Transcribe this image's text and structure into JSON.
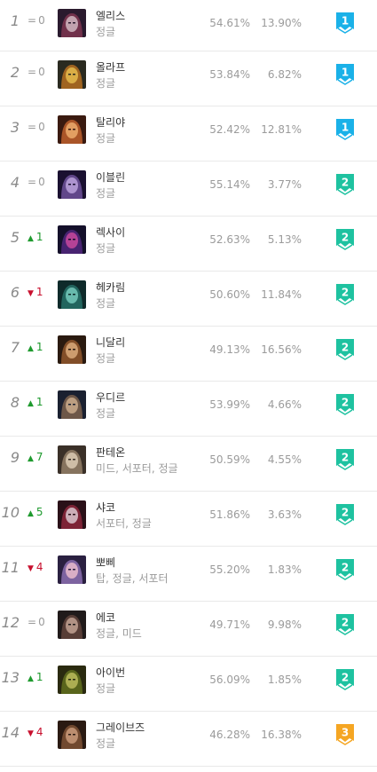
{
  "rows": [
    {
      "rank": "1",
      "change": "0",
      "dir": "same",
      "name": "엘리스",
      "role": "정글",
      "win": "54.61%",
      "pick": "13.90%",
      "tier": "1",
      "tierColor": "#1ab1e8",
      "avatar": {
        "bg": "#2a1a2e",
        "face": "#8a3a55",
        "accent": "#d7c0c8"
      }
    },
    {
      "rank": "2",
      "change": "0",
      "dir": "same",
      "name": "올라프",
      "role": "정글",
      "win": "53.84%",
      "pick": "6.82%",
      "tier": "1",
      "tierColor": "#1ab1e8",
      "avatar": {
        "bg": "#2a2a20",
        "face": "#c87820",
        "accent": "#e8c050"
      }
    },
    {
      "rank": "3",
      "change": "0",
      "dir": "same",
      "name": "탈리야",
      "role": "정글",
      "win": "52.42%",
      "pick": "12.81%",
      "tier": "1",
      "tierColor": "#1ab1e8",
      "avatar": {
        "bg": "#3a1a10",
        "face": "#d06a30",
        "accent": "#f0b070"
      }
    },
    {
      "rank": "4",
      "change": "0",
      "dir": "same",
      "name": "이블린",
      "role": "정글",
      "win": "55.14%",
      "pick": "3.77%",
      "tier": "2",
      "tierColor": "#1ec2a0",
      "avatar": {
        "bg": "#1a1030",
        "face": "#7a5aa8",
        "accent": "#c0a8e0"
      }
    },
    {
      "rank": "5",
      "change": "1",
      "dir": "up",
      "name": "렉사이",
      "role": "정글",
      "win": "52.63%",
      "pick": "5.13%",
      "tier": "2",
      "tierColor": "#1ec2a0",
      "avatar": {
        "bg": "#14102a",
        "face": "#5a2a8a",
        "accent": "#d04aa0"
      }
    },
    {
      "rank": "6",
      "change": "1",
      "dir": "down",
      "name": "헤카림",
      "role": "정글",
      "win": "50.60%",
      "pick": "11.84%",
      "tier": "2",
      "tierColor": "#1ec2a0",
      "avatar": {
        "bg": "#0e2a2a",
        "face": "#2a7a70",
        "accent": "#7ad0c0"
      }
    },
    {
      "rank": "7",
      "change": "1",
      "dir": "up",
      "name": "니달리",
      "role": "정글",
      "win": "49.13%",
      "pick": "16.56%",
      "tier": "2",
      "tierColor": "#1ec2a0",
      "avatar": {
        "bg": "#2a1a10",
        "face": "#a06030",
        "accent": "#e0b080"
      }
    },
    {
      "rank": "8",
      "change": "1",
      "dir": "up",
      "name": "우디르",
      "role": "정글",
      "win": "53.99%",
      "pick": "4.66%",
      "tier": "2",
      "tierColor": "#1ec2a0",
      "avatar": {
        "bg": "#1a2030",
        "face": "#8a6a50",
        "accent": "#d0b090"
      }
    },
    {
      "rank": "9",
      "change": "7",
      "dir": "up",
      "name": "판테온",
      "role": "미드, 서포터, 정글",
      "win": "50.59%",
      "pick": "4.55%",
      "tier": "2",
      "tierColor": "#1ec2a0",
      "avatar": {
        "bg": "#3a3028",
        "face": "#a08a70",
        "accent": "#e0d0b8"
      }
    },
    {
      "rank": "10",
      "change": "5",
      "dir": "up",
      "name": "샤코",
      "role": "서포터, 정글",
      "win": "51.86%",
      "pick": "3.63%",
      "tier": "2",
      "tierColor": "#1ec2a0",
      "avatar": {
        "bg": "#2a1018",
        "face": "#9a2a40",
        "accent": "#e0d0d8"
      }
    },
    {
      "rank": "11",
      "change": "4",
      "dir": "down",
      "name": "뽀삐",
      "role": "탑, 정글, 서포터",
      "win": "55.20%",
      "pick": "1.83%",
      "tier": "2",
      "tierColor": "#1ec2a0",
      "avatar": {
        "bg": "#2a2040",
        "face": "#9a7ac0",
        "accent": "#f0c0d0"
      }
    },
    {
      "rank": "12",
      "change": "0",
      "dir": "same",
      "name": "에코",
      "role": "정글, 미드",
      "win": "49.71%",
      "pick": "9.98%",
      "tier": "2",
      "tierColor": "#1ec2a0",
      "avatar": {
        "bg": "#201a1a",
        "face": "#6a4a40",
        "accent": "#c8a898"
      }
    },
    {
      "rank": "13",
      "change": "1",
      "dir": "up",
      "name": "아이번",
      "role": "정글",
      "win": "56.09%",
      "pick": "1.85%",
      "tier": "2",
      "tierColor": "#1ec2a0",
      "avatar": {
        "bg": "#2a2a10",
        "face": "#6a7a20",
        "accent": "#c0c060"
      }
    },
    {
      "rank": "14",
      "change": "4",
      "dir": "down",
      "name": "그레이브즈",
      "role": "정글",
      "win": "46.28%",
      "pick": "16.38%",
      "tier": "3",
      "tierColor": "#f5a623",
      "avatar": {
        "bg": "#2a1a12",
        "face": "#8a5a3a",
        "accent": "#d0a080"
      }
    }
  ]
}
